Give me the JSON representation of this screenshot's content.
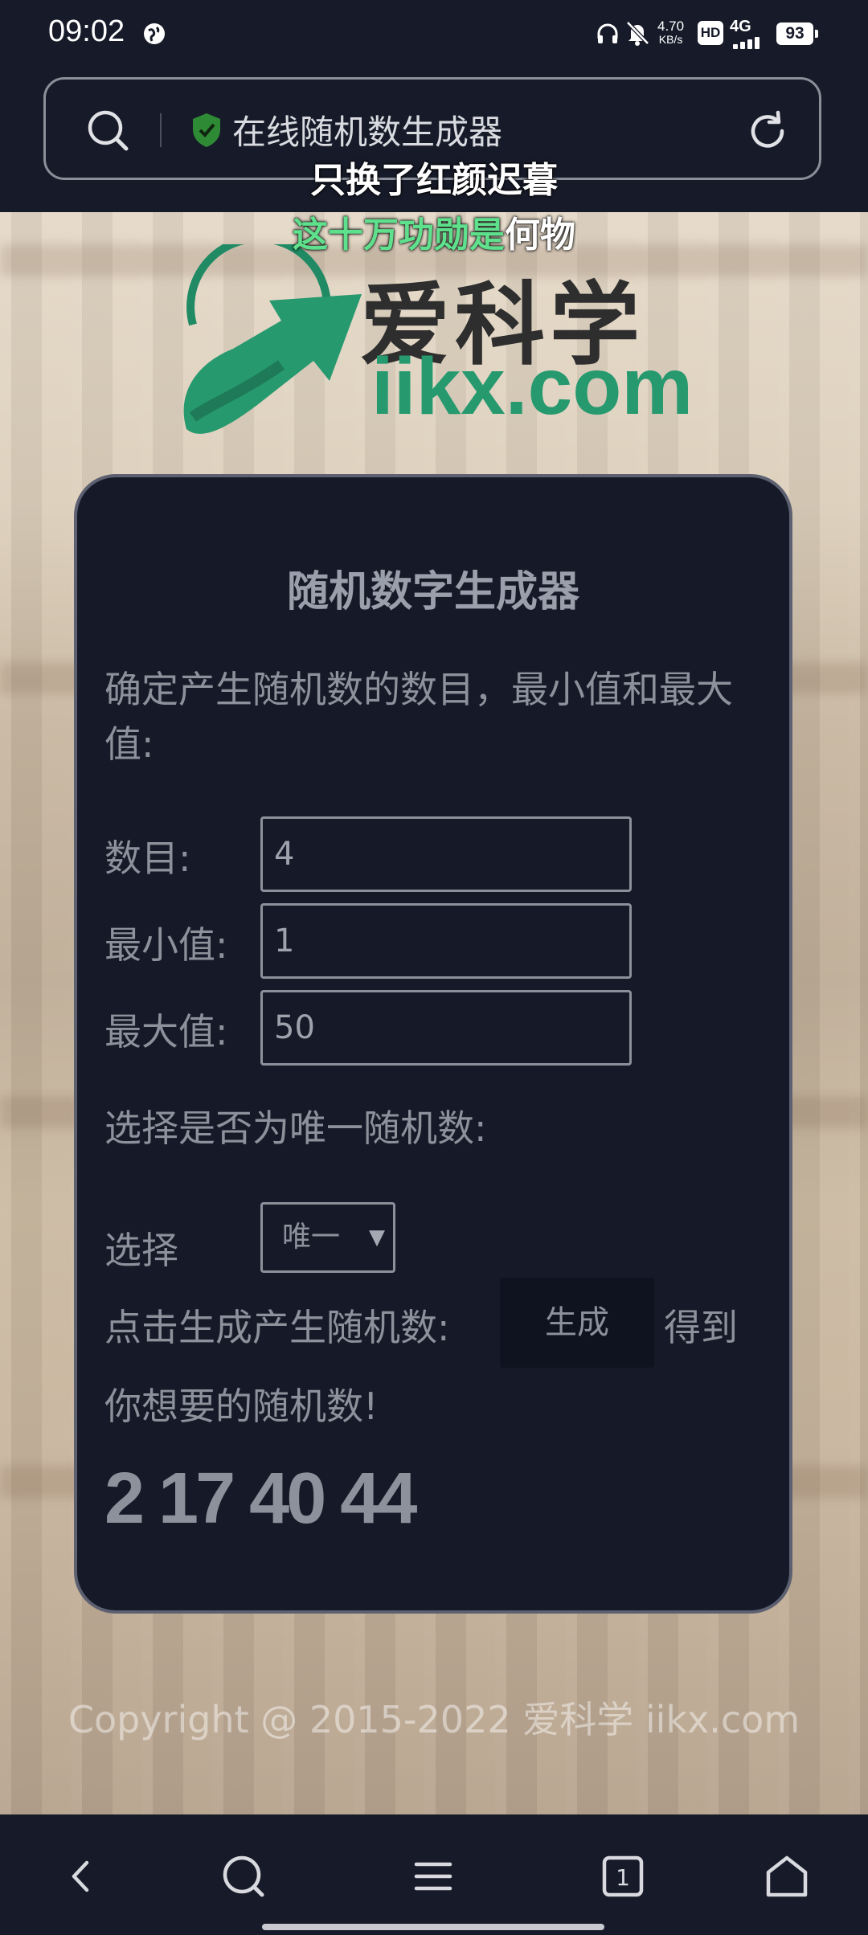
{
  "status_bar": {
    "time": "09:02",
    "speed_value": "4.70",
    "speed_unit": "KB/s",
    "hd": "HD",
    "network": "4G",
    "battery": "93"
  },
  "address_bar": {
    "title": "在线随机数生成器"
  },
  "lyrics": {
    "line1": "只换了红颜迟暮",
    "line2_highlight": "这十万功勋是",
    "line2_rest": "何物"
  },
  "logo": {
    "cn": "爱科学",
    "en": "iikx.com"
  },
  "card": {
    "title": "随机数字生成器",
    "description": "确定产生随机数的数目，最小值和最大值:",
    "fields": [
      {
        "label": "数目:",
        "value": "4"
      },
      {
        "label": "最小值:",
        "value": "1"
      },
      {
        "label": "最大值:",
        "value": "50"
      }
    ],
    "unique_question": "选择是否为唯一随机数:",
    "select_label": "选择",
    "select_value": "唯一",
    "generate_prefix": "点击生成产生随机数:",
    "generate_button": "生成",
    "generate_suffix": "得到",
    "generate_suffix2": "你想要的随机数!",
    "result": "2 17 40 44"
  },
  "footer": {
    "copyright": "Copyright @ 2015-2022   爱科学 iikx.com"
  },
  "colors": {
    "background": "#161a28",
    "logo_green": "#26996f"
  }
}
